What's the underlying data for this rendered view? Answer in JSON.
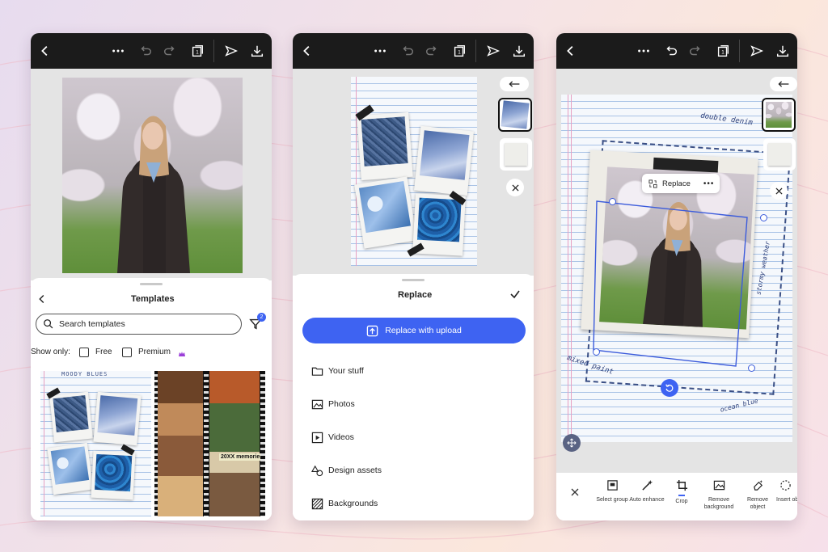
{
  "phone1": {
    "templates_title": "Templates",
    "search_placeholder": "Search templates",
    "filter_badge": "2",
    "show_only_label": "Show only:",
    "free_label": "Free",
    "premium_label": "Premium",
    "template_moody_title": "MOODY BLUES",
    "template_film_caption": "20XX memories"
  },
  "phone2": {
    "sheet_title": "Replace",
    "upload_button": "Replace with upload",
    "menu": [
      {
        "label": "Your stuff",
        "icon": "folder-icon"
      },
      {
        "label": "Photos",
        "icon": "image-icon"
      },
      {
        "label": "Videos",
        "icon": "play-icon"
      },
      {
        "label": "Design assets",
        "icon": "shapes-icon"
      },
      {
        "label": "Backgrounds",
        "icon": "pattern-icon"
      }
    ]
  },
  "phone3": {
    "replace_chip": "Replace",
    "handwriting": [
      "double denim",
      "mixed paint",
      "ocean blue",
      "stormy weather"
    ],
    "tools": [
      {
        "label": "Select group",
        "icon": "select-group-icon"
      },
      {
        "label": "Auto enhance",
        "icon": "magic-wand-icon"
      },
      {
        "label": "Crop",
        "icon": "crop-icon"
      },
      {
        "label": "Remove background",
        "icon": "remove-background-icon"
      },
      {
        "label": "Remove object",
        "icon": "eraser-icon"
      },
      {
        "label": "Insert object",
        "icon": "insert-object-icon"
      }
    ]
  },
  "colors": {
    "accent": "#3e63f2",
    "topbar": "#1b1b1b",
    "selection": "#3b5bdb"
  }
}
